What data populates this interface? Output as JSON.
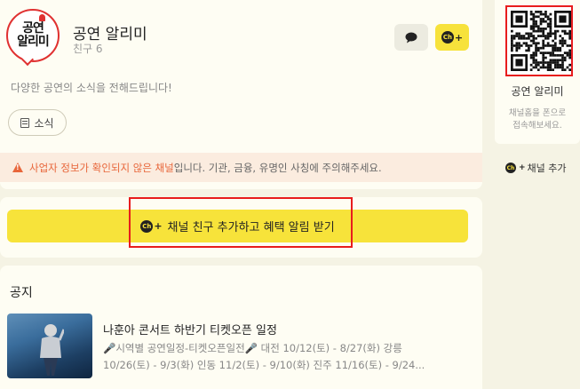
{
  "channel": {
    "logo_line1": "공연",
    "logo_line2": "알리미",
    "name": "공연 알리미",
    "friends": "친구 6",
    "description": "다양한 공연의 소식을 전해드립니다!",
    "news_button": "소식"
  },
  "warning": {
    "strong": "사업자 정보가 확인되지 않은 채널",
    "rest": "입니다. 기관, 금융, 유명인 사칭에 주의해주세요."
  },
  "cta": {
    "badge": "Ch",
    "label": "채널 친구 추가하고 혜택 알림 받기"
  },
  "notice": {
    "section_title": "공지",
    "item_title": "나훈아 콘서트 하반기 티켓오픈 일정",
    "item_body": "🎤시역별 공연일정-티켓오픈일전🎤 대전 10/12(토) - 8/27(화) 강릉 10/26(토) - 9/3(화) 인동 11/2(토) - 9/10(화) 진주 11/16(토) - 9/24..."
  },
  "side": {
    "name": "공연 알리미",
    "help_line1": "채널홈을 폰으로",
    "help_line2": "접속해보세요.",
    "add_label": "채널 추가"
  },
  "colors": {
    "accent_yellow": "#f7e33a",
    "warning_orange": "#e8663a",
    "highlight_red": "#e81d1d"
  }
}
